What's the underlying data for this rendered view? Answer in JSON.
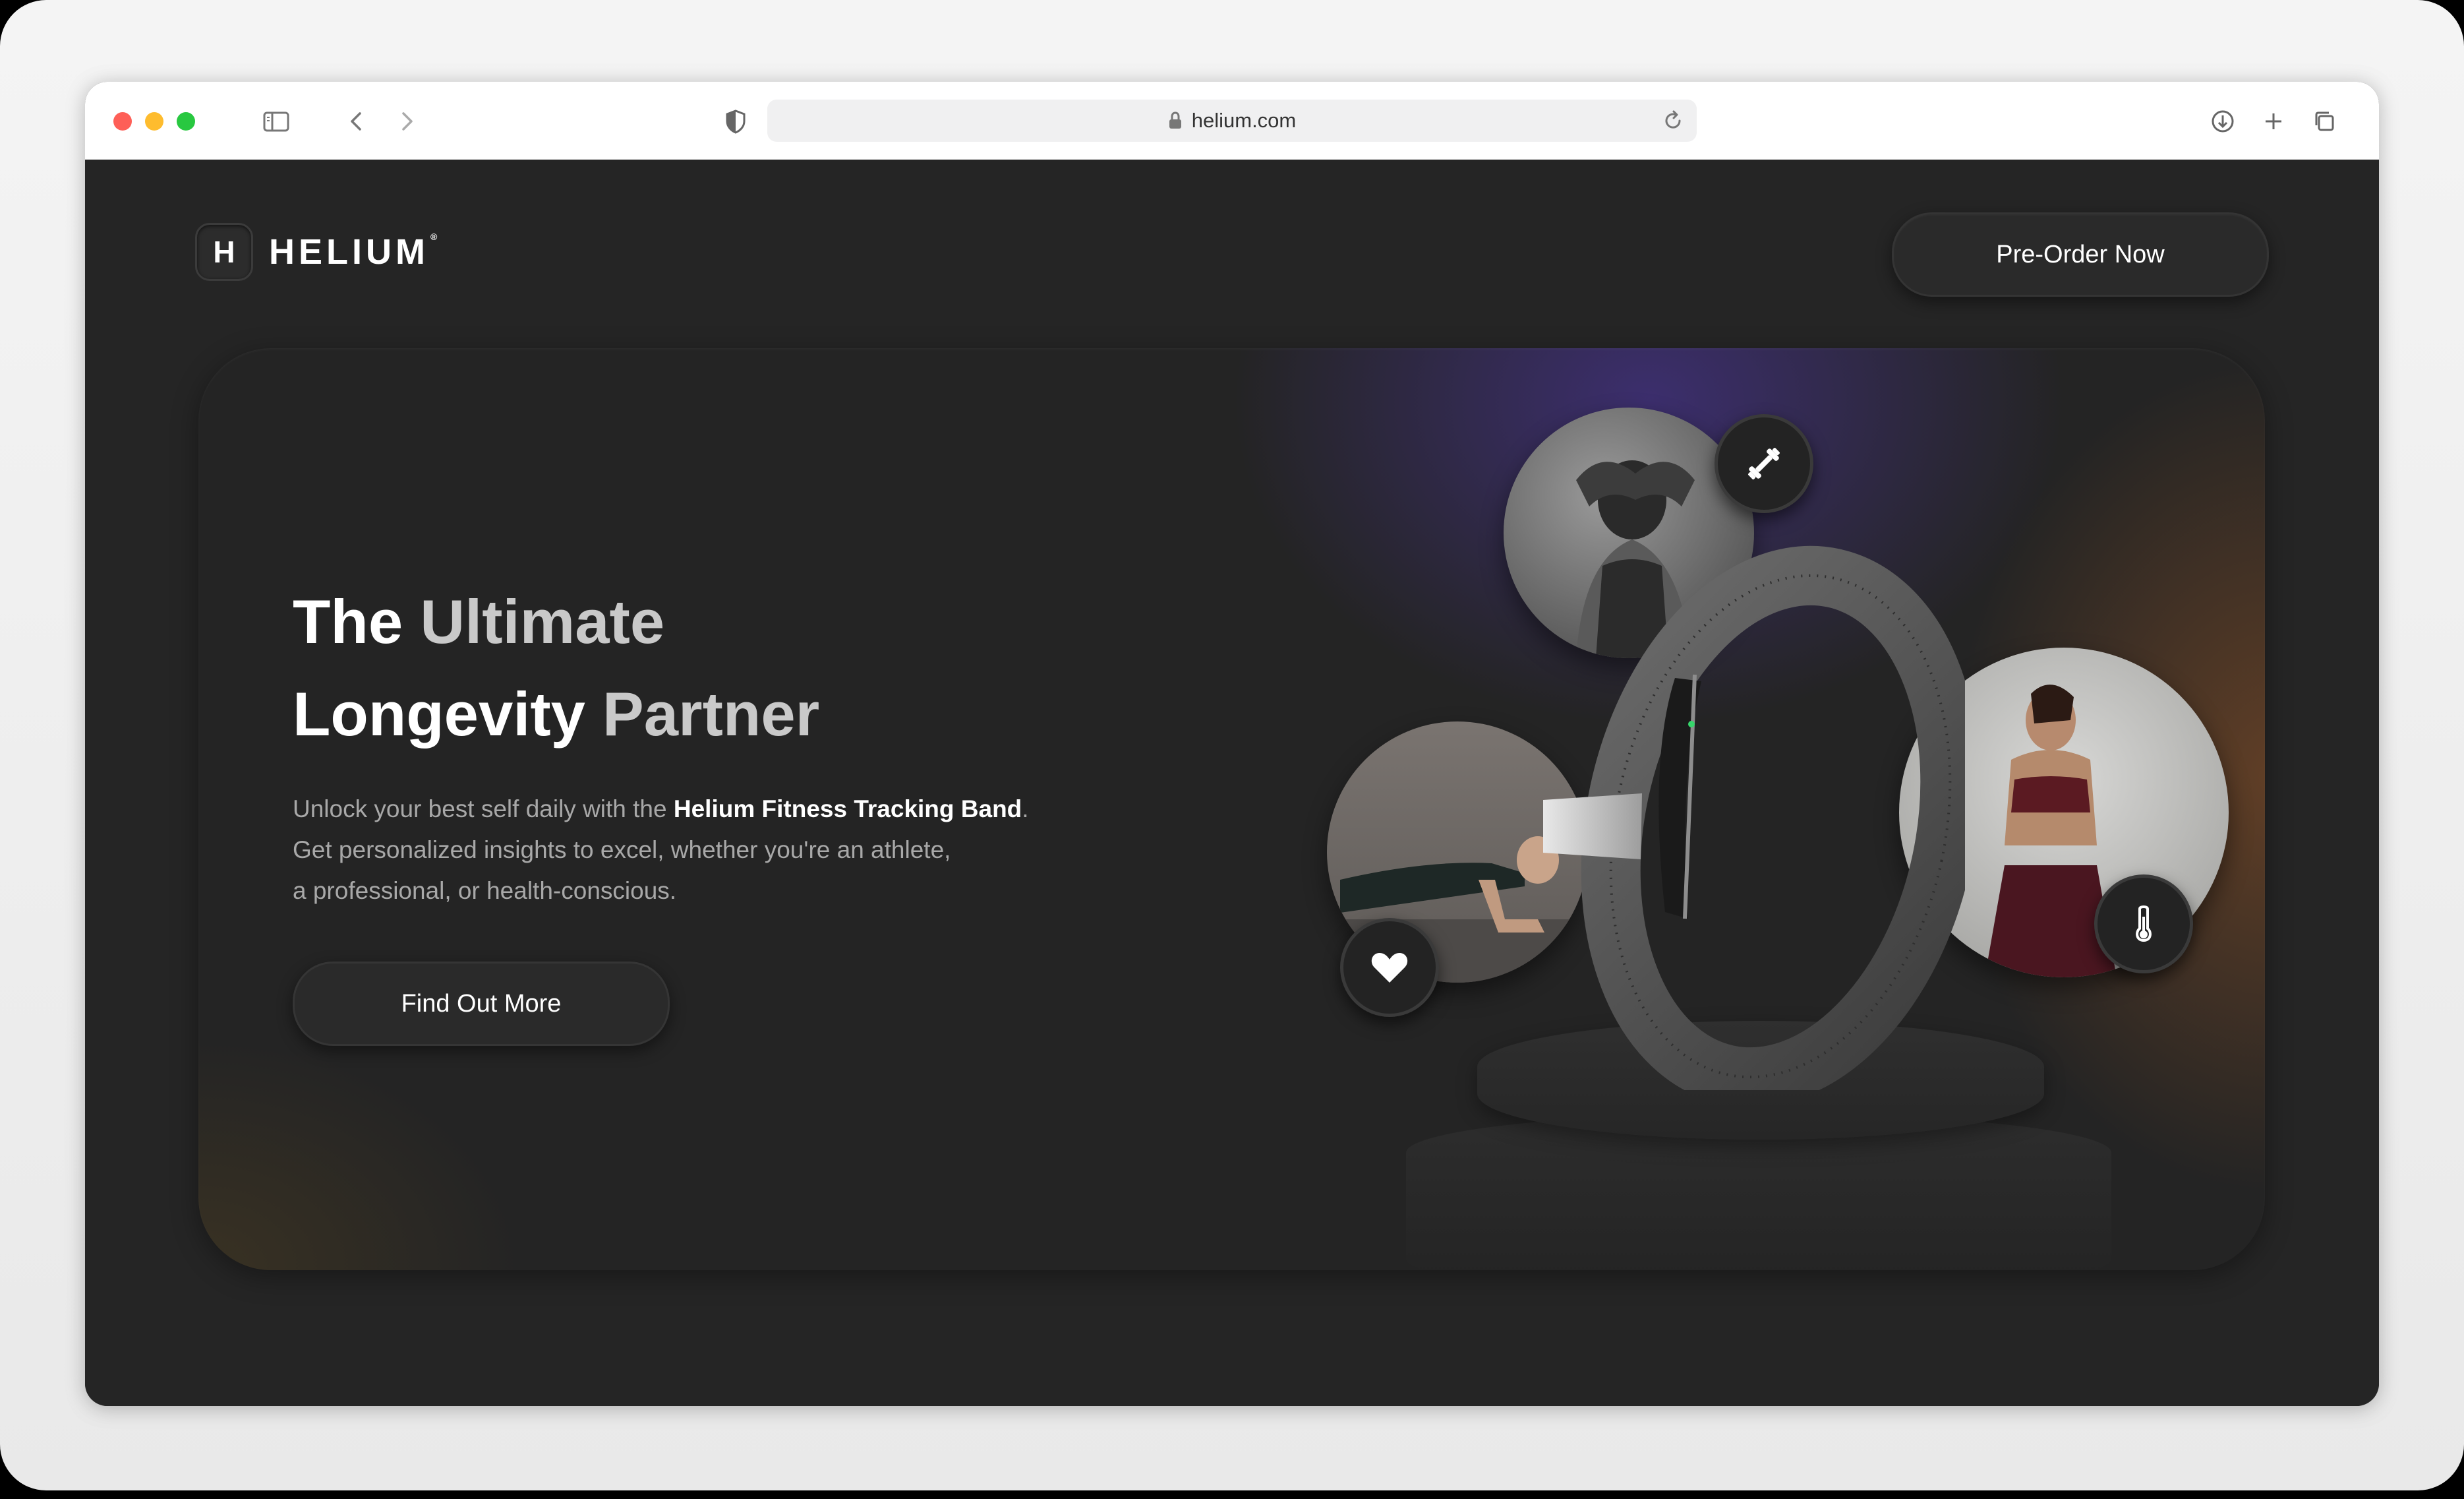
{
  "browser": {
    "url": "helium.com"
  },
  "brand": {
    "logo_letter": "H",
    "name": "HELIUM",
    "registered": "®"
  },
  "header": {
    "cta_label": "Pre-Order Now"
  },
  "hero": {
    "title_line1_a": "The ",
    "title_line1_b": "Ultimate",
    "title_line2_a": "Longevity ",
    "title_line2_b": "Partner",
    "desc_a": "Unlock your best self daily with the ",
    "desc_bold": "Helium Fitness Tracking Band",
    "desc_b": ".",
    "desc_line2": "Get personalized insights to excel, whether you're an athlete,",
    "desc_line3": "a professional, or health-conscious.",
    "button_label": "Find Out More"
  },
  "feature_badges": [
    "dumbbell-icon",
    "heart-icon",
    "thermometer-icon"
  ],
  "colors": {
    "background": "#252525",
    "accent_purple": "#5037aa",
    "accent_orange": "#aa5f28",
    "text_primary": "#ffffff",
    "text_muted": "#a8a8a8"
  }
}
